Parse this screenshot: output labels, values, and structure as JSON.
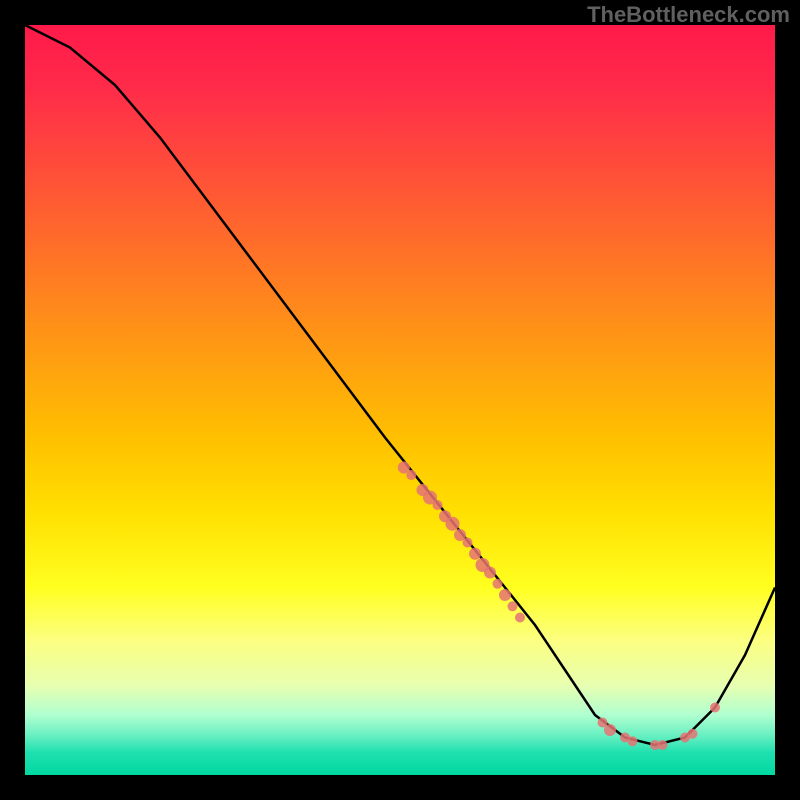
{
  "watermark": "TheBottleneck.com",
  "chart_data": {
    "type": "line",
    "title": "",
    "xlabel": "",
    "ylabel": "",
    "xlim": [
      0,
      100
    ],
    "ylim": [
      0,
      100
    ],
    "grid": false,
    "curve": {
      "x": [
        0,
        6,
        12,
        18,
        24,
        30,
        36,
        42,
        48,
        52,
        56,
        60,
        64,
        68,
        72,
        76,
        80,
        84,
        88,
        92,
        96,
        100
      ],
      "y": [
        100,
        97,
        92,
        85,
        77,
        69,
        61,
        53,
        45,
        40,
        35,
        30,
        25,
        20,
        14,
        8,
        5,
        4,
        5,
        9,
        16,
        25
      ]
    },
    "markers": [
      {
        "x": 50.5,
        "y": 41,
        "r": 6
      },
      {
        "x": 51.5,
        "y": 40,
        "r": 5
      },
      {
        "x": 53,
        "y": 38,
        "r": 6
      },
      {
        "x": 54,
        "y": 37,
        "r": 7
      },
      {
        "x": 55,
        "y": 36,
        "r": 5
      },
      {
        "x": 56,
        "y": 34.5,
        "r": 6
      },
      {
        "x": 57,
        "y": 33.5,
        "r": 7
      },
      {
        "x": 58,
        "y": 32,
        "r": 6
      },
      {
        "x": 59,
        "y": 31,
        "r": 5
      },
      {
        "x": 60,
        "y": 29.5,
        "r": 6
      },
      {
        "x": 61,
        "y": 28,
        "r": 7
      },
      {
        "x": 62,
        "y": 27,
        "r": 6
      },
      {
        "x": 63,
        "y": 25.5,
        "r": 5
      },
      {
        "x": 64,
        "y": 24,
        "r": 6
      },
      {
        "x": 65,
        "y": 22.5,
        "r": 5
      },
      {
        "x": 66,
        "y": 21,
        "r": 5
      },
      {
        "x": 77,
        "y": 7,
        "r": 5
      },
      {
        "x": 78,
        "y": 6,
        "r": 6
      },
      {
        "x": 80,
        "y": 5,
        "r": 5
      },
      {
        "x": 81,
        "y": 4.5,
        "r": 5
      },
      {
        "x": 84,
        "y": 4,
        "r": 5
      },
      {
        "x": 85,
        "y": 4,
        "r": 5
      },
      {
        "x": 88,
        "y": 5,
        "r": 5
      },
      {
        "x": 89,
        "y": 5.5,
        "r": 5
      },
      {
        "x": 92,
        "y": 9,
        "r": 5
      }
    ],
    "marker_color": "#e57373",
    "curve_color": "#000000"
  }
}
